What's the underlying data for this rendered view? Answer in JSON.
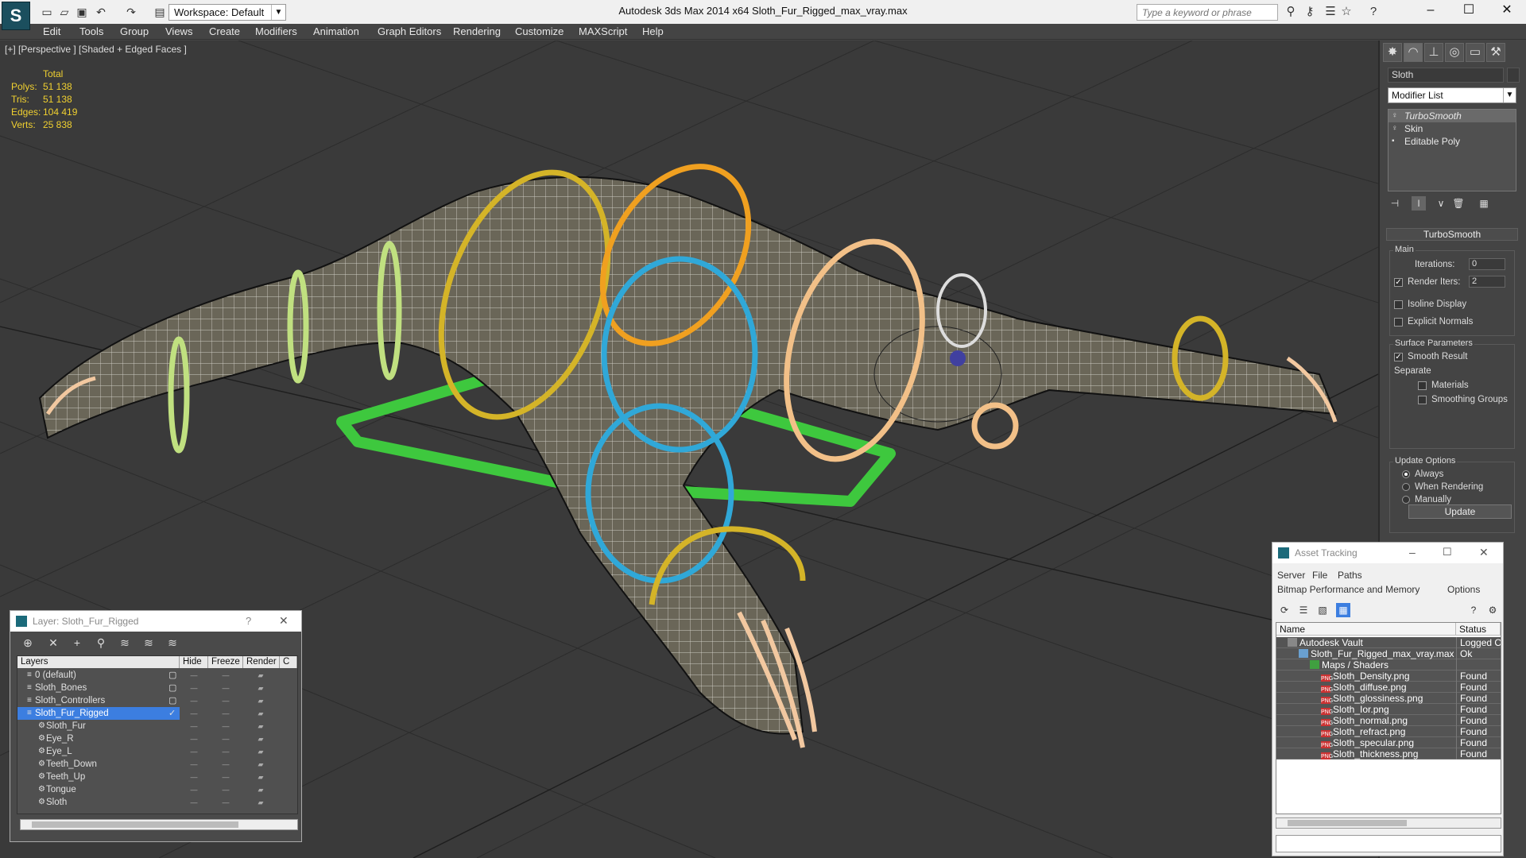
{
  "titlebar": {
    "workspace": "Workspace: Default",
    "app_title": "Autodesk 3ds Max  2014 x64        Sloth_Fur_Rigged_max_vray.max",
    "search_placeholder": "Type a keyword or phrase"
  },
  "menu": [
    "Edit",
    "Tools",
    "Group",
    "Views",
    "Create",
    "Modifiers",
    "Animation",
    "Graph Editors",
    "Rendering",
    "Customize",
    "MAXScript",
    "Help"
  ],
  "viewport": {
    "label": "[+] [Perspective ] [Shaded + Edged Faces ]",
    "stats": {
      "header": "Total",
      "rows": [
        {
          "k": "Polys:",
          "v": "51 138"
        },
        {
          "k": "Tris:",
          "v": "51 138"
        },
        {
          "k": "Edges:",
          "v": "104 419"
        },
        {
          "k": "Verts:",
          "v": "25 838"
        }
      ]
    }
  },
  "command_panel": {
    "object_name": "Sloth",
    "modifier_list": "Modifier List",
    "stack": [
      "TurboSmooth",
      "Skin",
      "Editable Poly"
    ],
    "rollout_title": "TurboSmooth",
    "main_group": "Main",
    "iterations_label": "Iterations:",
    "iterations_value": "0",
    "render_iters_label": "Render Iters:",
    "render_iters_value": "2",
    "isoline": "Isoline Display",
    "explicit_normals": "Explicit Normals",
    "surface_group": "Surface Parameters",
    "smooth_result": "Smooth Result",
    "separate": "Separate",
    "materials": "Materials",
    "smoothing_groups": "Smoothing Groups",
    "update_group": "Update Options",
    "always": "Always",
    "when_rendering": "When Rendering",
    "manually": "Manually",
    "update_button": "Update"
  },
  "layer_window": {
    "title": "Layer: Sloth_Fur_Rigged",
    "columns": [
      "Layers",
      "Hide",
      "Freeze",
      "Render",
      "C"
    ],
    "rows": [
      {
        "name": "0 (default)"
      },
      {
        "name": "Sloth_Bones"
      },
      {
        "name": "Sloth_Controllers"
      },
      {
        "name": "Sloth_Fur_Rigged"
      },
      {
        "name": "Sloth_Fur"
      },
      {
        "name": "Eye_R"
      },
      {
        "name": "Eye_L"
      },
      {
        "name": "Teeth_Down"
      },
      {
        "name": "Teeth_Up"
      },
      {
        "name": "Tongue"
      },
      {
        "name": "Sloth"
      }
    ]
  },
  "asset_window": {
    "title": "Asset Tracking",
    "menu1": [
      "Server",
      "File",
      "Paths"
    ],
    "menu2": [
      "Bitmap Performance and Memory",
      "Options"
    ],
    "columns": [
      "Name",
      "Status"
    ],
    "rows": [
      {
        "name": "Autodesk Vault",
        "status": "Logged O"
      },
      {
        "name": "Sloth_Fur_Rigged_max_vray.max",
        "status": "Ok"
      },
      {
        "name": "Maps / Shaders",
        "status": ""
      },
      {
        "name": "Sloth_Density.png",
        "status": "Found"
      },
      {
        "name": "Sloth_diffuse.png",
        "status": "Found"
      },
      {
        "name": "Sloth_glossiness.png",
        "status": "Found"
      },
      {
        "name": "Sloth_Ior.png",
        "status": "Found"
      },
      {
        "name": "Sloth_normal.png",
        "status": "Found"
      },
      {
        "name": "Sloth_refract.png",
        "status": "Found"
      },
      {
        "name": "Sloth_specular.png",
        "status": "Found"
      },
      {
        "name": "Sloth_thickness.png",
        "status": "Found"
      }
    ]
  },
  "colors": {
    "stats_yellow": "#f0d030",
    "selection_blue": "#3c7ee0",
    "ctrl_green": "#3ec83e",
    "ctrl_yellow": "#d4b428",
    "ctrl_orange": "#f0a020",
    "ctrl_blue": "#30a8d8",
    "ctrl_peach": "#f2c088",
    "ctrl_lime": "#c0e080"
  }
}
